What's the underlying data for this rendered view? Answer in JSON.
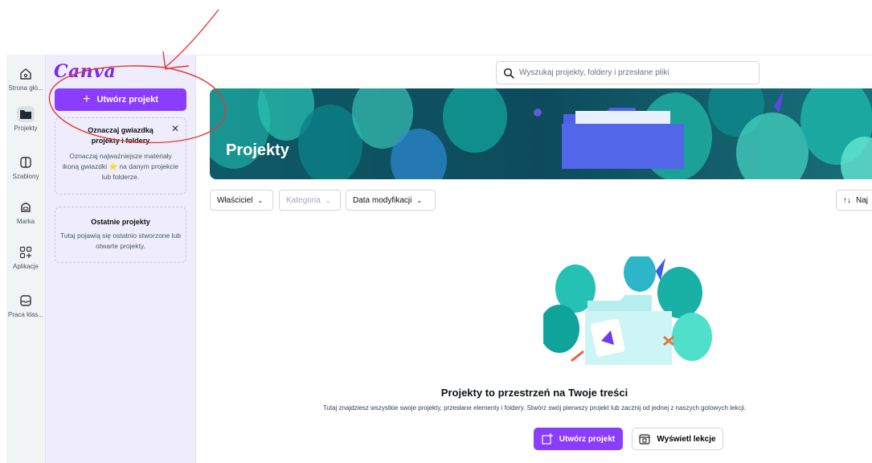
{
  "rail": {
    "items": [
      {
        "label": "Strona głó...",
        "icon": "home-icon"
      },
      {
        "label": "Projekty",
        "icon": "folder-icon",
        "active": true
      },
      {
        "label": "Szablony",
        "icon": "templates-icon"
      },
      {
        "label": "Marka",
        "icon": "brand-icon"
      },
      {
        "label": "Aplikacje",
        "icon": "apps-icon"
      },
      {
        "label": "Praca klas...",
        "icon": "classwork-icon"
      }
    ]
  },
  "panel": {
    "logo": "Canva",
    "create_label": "Utwórz projekt",
    "star_card": {
      "title": "Oznaczaj gwiazdką projekty i foldery",
      "body": "Oznaczaj najważniejsze materiały ikoną gwiazdki ⭐ na danym projekcie lub folderze."
    },
    "recent_card": {
      "title": "Ostatnie projekty",
      "body": "Tutaj pojawią się ostatnio stworzone lub otwarte projekty."
    }
  },
  "search": {
    "placeholder": "Wyszukaj projekty, foldery i przesłane pliki"
  },
  "banner": {
    "title": "Projekty"
  },
  "filters": {
    "owner": "Właściciel",
    "category": "Kategoria",
    "modified": "Data modyfikacji",
    "sort": "Naj"
  },
  "empty": {
    "title": "Projekty to przestrzeń na Twoje treści",
    "description": "Tutaj znajdziesz wszystkie swoje projekty, przesłane elementy i foldery. Stwórz swój pierwszy projekt lub zacznij od jednej z naszych gotowych lekcji.",
    "primary_label": "Utwórz projekt",
    "secondary_label": "Wyświetl lekcje"
  },
  "colors": {
    "accent": "#8b3dff",
    "panel_bg": "#efedfc",
    "annotation": "#e53935"
  }
}
